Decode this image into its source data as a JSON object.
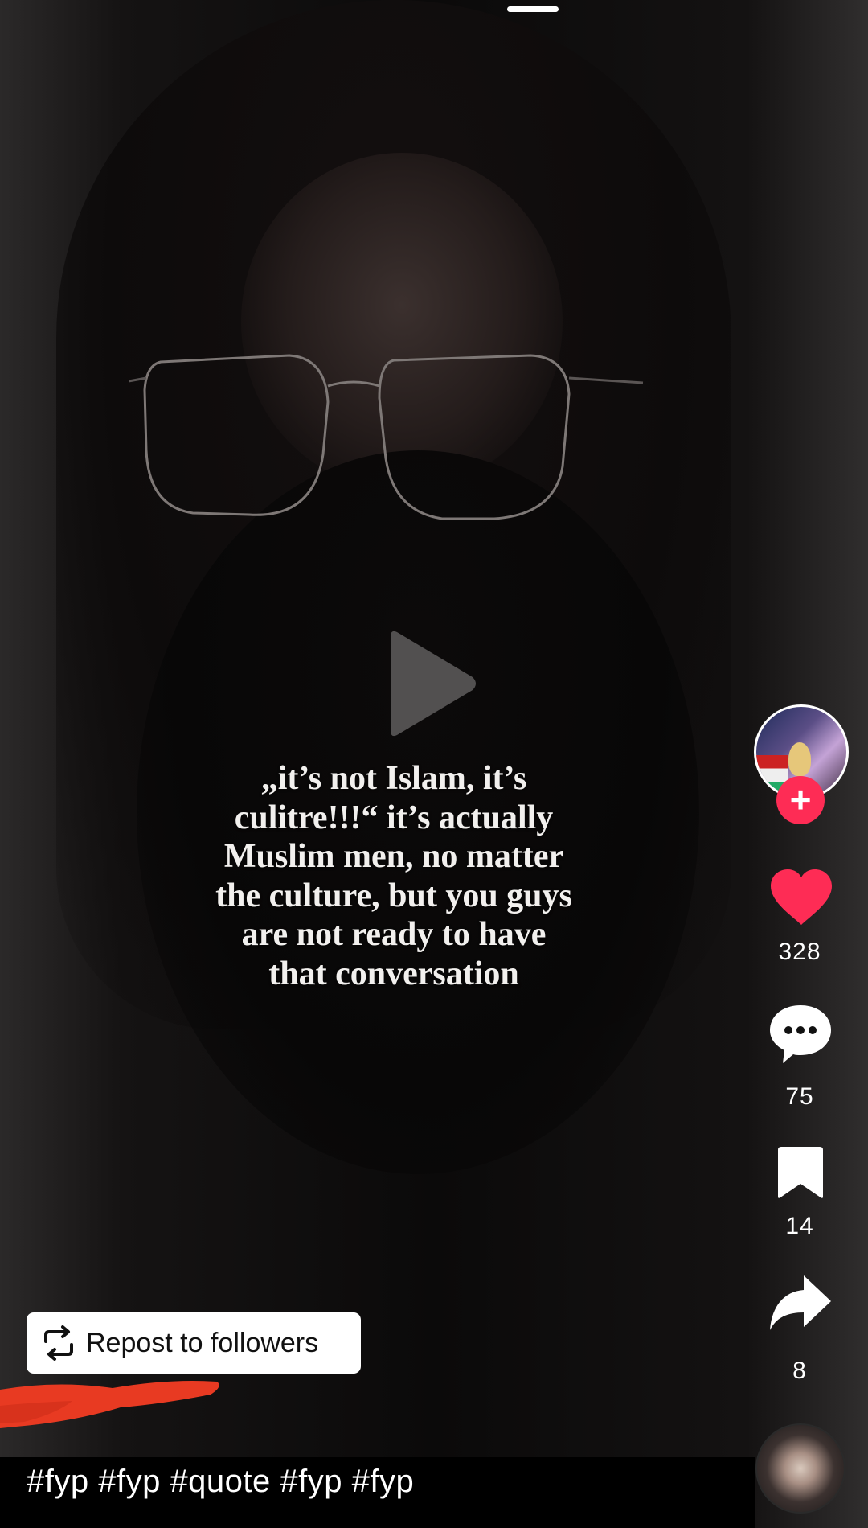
{
  "video": {
    "caption_lines": [
      "„it’s not Islam, it’s",
      "culitre!!!“ it’s actually",
      "Muslim men, no matter",
      "the culture, but you guys",
      "are not ready to have",
      "that conversation"
    ],
    "state_icon": "play-icon"
  },
  "actions": {
    "follow_icon": "plus-icon",
    "like": {
      "icon": "heart-icon",
      "count": "328",
      "color": "#fe2c55"
    },
    "comment": {
      "icon": "comment-icon",
      "count": "75"
    },
    "favorite": {
      "icon": "bookmark-icon",
      "count": "14"
    },
    "share": {
      "icon": "share-icon",
      "count": "8"
    },
    "music_icon": "music-disc"
  },
  "repost": {
    "label": "Repost to followers",
    "icon": "repost-icon"
  },
  "post": {
    "hashtags": "#fyp #fyp #quote #fyp #fyp"
  },
  "colors": {
    "accent": "#fe2c55",
    "redaction": "#e83a22"
  }
}
